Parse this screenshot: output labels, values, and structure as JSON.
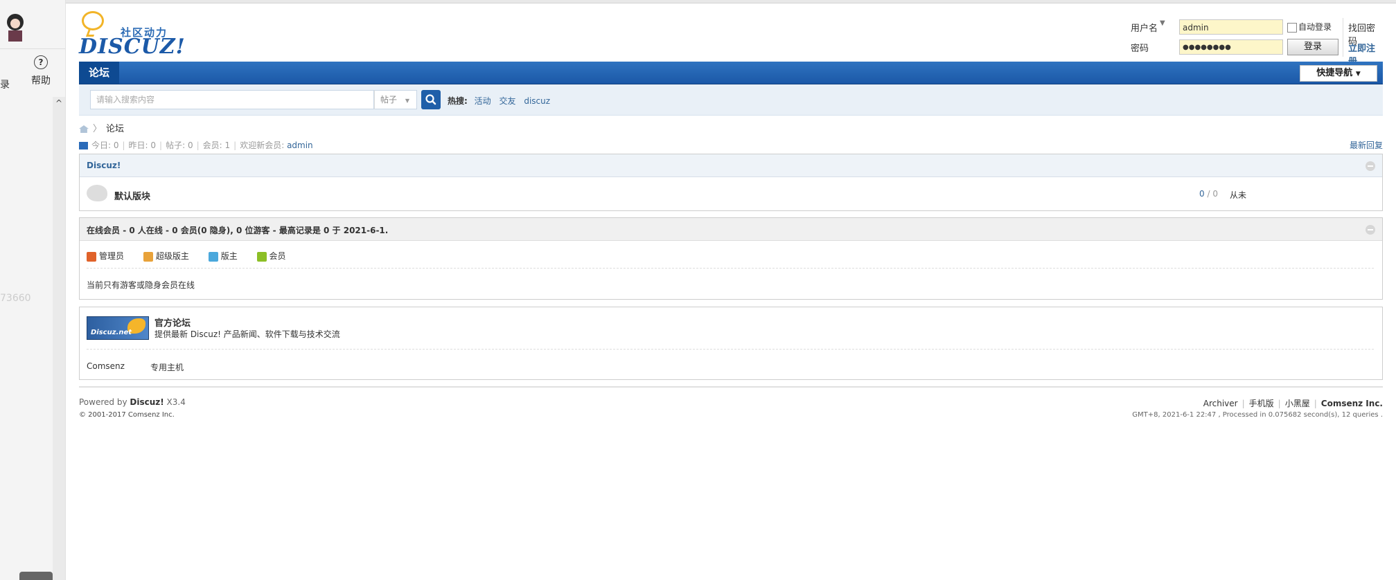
{
  "sidebar": {
    "left_char": "录",
    "help_label": "帮助",
    "help_glyph": "?",
    "scroll_up_glyph": "^",
    "number_text": "73660"
  },
  "header": {
    "slogan": "社区动力",
    "brand": "DISCUZ!"
  },
  "login": {
    "username_label": "用户名",
    "username_value": "admin",
    "password_label": "密码",
    "password_value": "●●●●●●●●",
    "auto_login": "自动登录",
    "login_button": "登录",
    "forgot_password": "找回密码",
    "register": "立即注册"
  },
  "nav": {
    "forum_tab": "论坛",
    "quick_nav": "快捷导航"
  },
  "search": {
    "placeholder": "请输入搜索内容",
    "type": "帖子",
    "hot_label": "热搜:",
    "hot_items": [
      "活动",
      "交友",
      "discuz"
    ]
  },
  "breadcrumb": {
    "current": "论坛"
  },
  "stats": {
    "today": "今日: 0",
    "yesterday": "昨日: 0",
    "posts": "帖子: 0",
    "members": "会员: 1",
    "welcome_prefix": "欢迎新会员:",
    "welcome_user": "admin",
    "latest_reply": "最新回复"
  },
  "forum_group": {
    "title": "Discuz!",
    "forum_name": "默认版块",
    "threads": "0",
    "posts_sep": " / ",
    "posts": "0",
    "last_post": "从未"
  },
  "online": {
    "title_prefix": "在线会员",
    "title_text": " - 0 人在线 - 0 会员(0 隐身), 0 位游客 - 最高记录是 0 于 2021-6-1.",
    "legend": [
      {
        "label": "管理员",
        "color": "#e0622a"
      },
      {
        "label": "超级版主",
        "color": "#e8a23a"
      },
      {
        "label": "版主",
        "color": "#4ba8dc"
      },
      {
        "label": "会员",
        "color": "#8cbf26"
      }
    ],
    "message": "当前只有游客或隐身会员在线"
  },
  "links": {
    "banner_text": "Discuz.net",
    "name": "官方论坛",
    "description": "提供最新 Discuz! 产品新闻、软件下载与技术交流",
    "link1": "Comsenz",
    "link2": "专用主机"
  },
  "footer": {
    "powered_prefix": "Powered by ",
    "powered_brand": "Discuz!",
    "powered_version": " X3.4",
    "copyright": "© 2001-2017 Comsenz Inc.",
    "links": [
      "Archiver",
      "手机版",
      "小黑屋"
    ],
    "company": "Comsenz Inc.",
    "gmt": "GMT+8, 2021-6-1 22:47 , Processed in 0.075682 second(s), 12 queries ."
  }
}
